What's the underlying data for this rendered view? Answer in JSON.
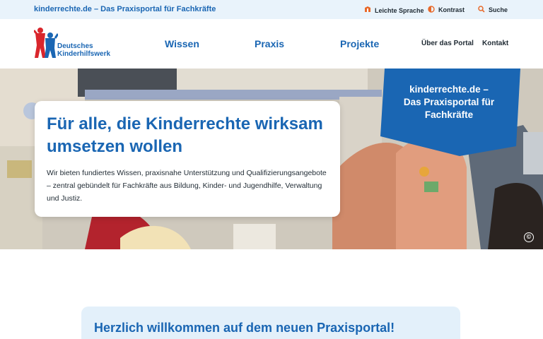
{
  "topbar": {
    "site_link": "kinderrechte.de – Das Praxisportal für Fachkräfte",
    "easy_language": "Leichte Sprache",
    "contrast": "Kontrast",
    "search": "Suche"
  },
  "header": {
    "logo_line1": "Deutsches",
    "logo_line2": "Kinderhilfswerk",
    "nav_main": [
      "Wissen",
      "Praxis",
      "Projekte"
    ],
    "nav_secondary": [
      "Über das Portal",
      "Kontakt"
    ]
  },
  "hero": {
    "title": "Für alle, die Kinderrechte wirksam umsetzen wollen",
    "text": "Wir bieten fundiertes Wissen, praxisnahe Unterstützung und Qualifizierungsangebote – zentral gebündelt für Fachkräfte aus Bildung, Kinder- und Jugendhilfe, Verwaltung und Justiz.",
    "badge_line1": "kinderrechte.de –",
    "badge_line2": "Das Praxisportal für",
    "badge_line3": "Fachkräfte",
    "copyright_symbol": "©"
  },
  "welcome": {
    "title": "Herzlich willkommen auf dem neuen Praxisportal!"
  },
  "colors": {
    "brand_blue": "#1a66b3",
    "accent_orange": "#e8692a",
    "topbar_bg": "#e9f3fb",
    "welcome_bg": "#e3f0fa"
  }
}
